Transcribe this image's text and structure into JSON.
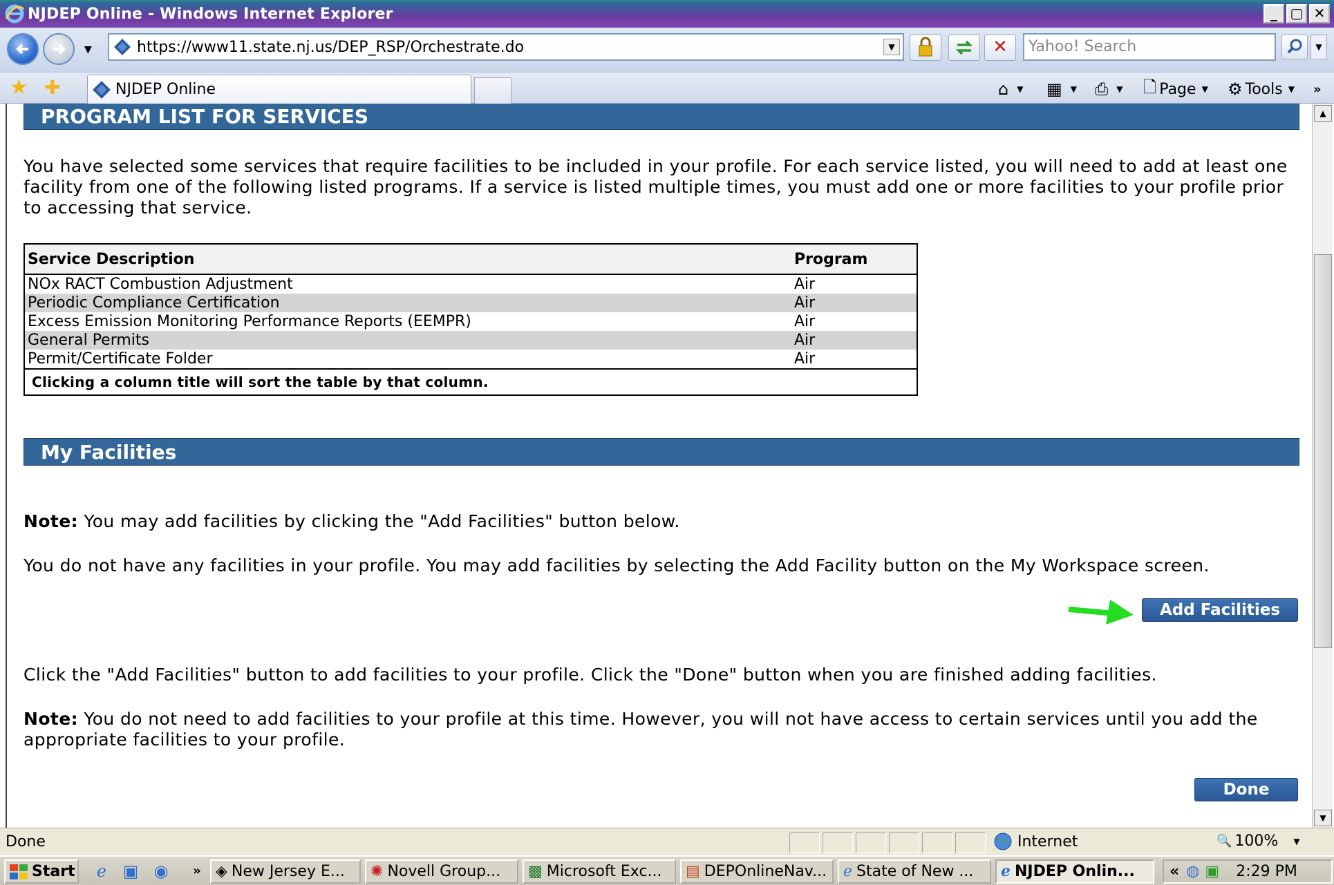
{
  "window": {
    "title": "NJDEP Online - Windows Internet Explorer",
    "min": "_",
    "max": "▢",
    "close": "✕"
  },
  "nav": {
    "url": "https://www11.state.nj.us/DEP_RSP/Orchestrate.do",
    "search_placeholder": "Yahoo! Search"
  },
  "tab": {
    "title": "NJDEP Online"
  },
  "commands": {
    "page": "Page",
    "tools": "Tools"
  },
  "program_list": {
    "heading": "PROGRAM LIST FOR SERVICES",
    "intro": "You have selected some services that require facilities to be included in your profile. For each service listed, you will need to add at least one facility from one of the following listed programs. If a service is listed multiple times, you must add one or more facilities to your profile prior to accessing that service.",
    "columns": [
      "Service Description",
      "Program"
    ],
    "rows": [
      [
        "NOx RACT Combustion Adjustment",
        "Air"
      ],
      [
        "Periodic Compliance Certification",
        "Air"
      ],
      [
        "Excess Emission Monitoring Performance Reports (EEMPR)",
        "Air"
      ],
      [
        "General Permits",
        "Air"
      ],
      [
        "Permit/Certificate Folder",
        "Air"
      ]
    ],
    "footer": "Clicking a column title will sort the table by that column."
  },
  "my_facilities": {
    "heading": "My Facilities",
    "note1_label": "Note:",
    "note1_text": " You may add facilities by clicking the \"Add Facilities\" button below.",
    "no_facilities": "You do not have any facilities in your profile. You may add facilities by selecting the Add Facility button on the My Workspace screen.",
    "add_button": "Add Facilities",
    "instructions": "Click the \"Add Facilities\" button to add facilities to your profile. Click the \"Done\" button when you are finished adding facilities.",
    "note2_label": "Note:",
    "note2_text": " You do not need to add facilities to your profile at this time. However, you will not have access to certain services until you add the appropriate facilities to your profile.",
    "done_button": "Done",
    "arrow_color": "#22dd22"
  },
  "status": {
    "text": "Done",
    "zone": "Internet",
    "zoom": "100%"
  },
  "taskbar": {
    "start": "Start",
    "tasks": [
      {
        "label": "New Jersey E...",
        "icon": "gem-icon"
      },
      {
        "label": "Novell Group...",
        "icon": "groupwise-icon"
      },
      {
        "label": "Microsoft Exc...",
        "icon": "excel-icon"
      },
      {
        "label": "DEPOnlineNav...",
        "icon": "powerpoint-icon"
      },
      {
        "label": "State of New ...",
        "icon": "ie-icon"
      },
      {
        "label": "NJDEP Onlin...",
        "icon": "ie-icon"
      }
    ],
    "clock": "2:29 PM"
  },
  "colors": {
    "section_bar": "#336699",
    "row_shade": "#d4d4d4",
    "button": "#2f5f9f"
  }
}
